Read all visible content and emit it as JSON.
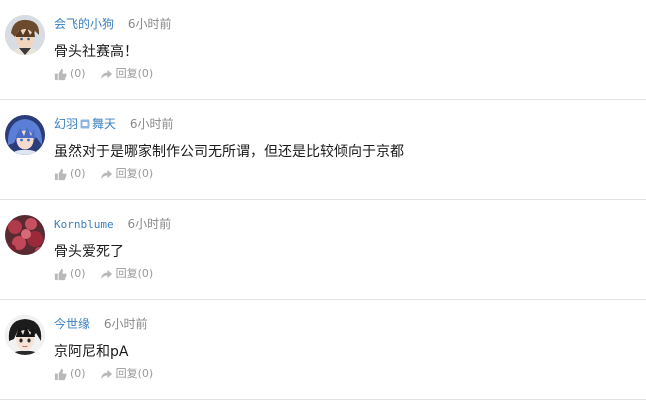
{
  "comments": [
    {
      "username": "会飞的小狗",
      "time": "6小时前",
      "content": "骨头社赛高！",
      "like_count": "(0)",
      "reply_label": "回复",
      "reply_count": "(0)",
      "avatar": "avatar-anime-boy-brown"
    },
    {
      "username_part1": "幻羽",
      "username_part2": "舞天",
      "time": "6小时前",
      "content": "虽然对于是哪家制作公司无所谓，但还是比较倾向于京都",
      "like_count": "(0)",
      "reply_label": "回复",
      "reply_count": "(0)",
      "avatar": "avatar-anime-blue-hair"
    },
    {
      "username": "Kornblume",
      "time": "6小时前",
      "content": "骨头爱死了",
      "like_count": "(0)",
      "reply_label": "回复",
      "reply_count": "(0)",
      "avatar": "avatar-red-flowers"
    },
    {
      "username": "今世缘",
      "time": "6小时前",
      "content": "京阿尼和pA",
      "like_count": "(0)",
      "reply_label": "回复",
      "reply_count": "(0)",
      "avatar": "avatar-anime-black-hair"
    }
  ],
  "colors": {
    "username": "#3a7fc0",
    "meta": "#888888",
    "divider": "#e2e2e2",
    "icon": "#b8b8b8"
  }
}
